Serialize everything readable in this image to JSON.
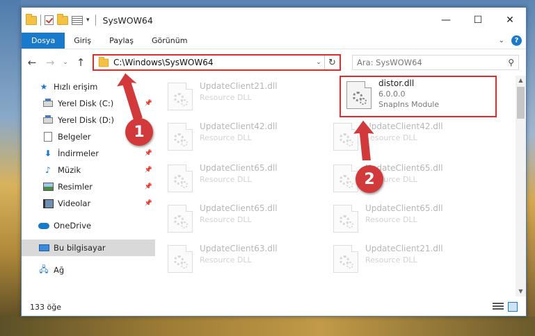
{
  "window": {
    "title": "SysWOW64",
    "controls": {
      "minimize": "—",
      "maximize": "☐",
      "close": "✕"
    }
  },
  "quick_access_toolbar": {
    "icons": [
      "folder-icon",
      "properties-check-icon",
      "new-folder-icon",
      "properties-icon",
      "dropdown-icon"
    ]
  },
  "ribbon": {
    "tabs": [
      "Dosya",
      "Giriş",
      "Paylaş",
      "Görünüm"
    ],
    "collapse_glyph": "⌄",
    "help_glyph": "?"
  },
  "navigation": {
    "back_glyph": "←",
    "forward_glyph": "→",
    "recent_glyph": "⌄",
    "up_glyph": "↑",
    "address_path": "C:\\Windows\\SysWOW64",
    "address_dropdown_glyph": "⌄",
    "refresh_glyph": "↻",
    "search_placeholder": "Ara: SysWOW64",
    "search_glyph": "⚲"
  },
  "sidebar": {
    "quick_access": "Hızlı erişim",
    "items": [
      {
        "label": "Yerel Disk (C:)",
        "icon": "drive-icon"
      },
      {
        "label": "Yerel Disk (D:)",
        "icon": "drive-icon"
      },
      {
        "label": "Belgeler",
        "icon": "documents-icon"
      },
      {
        "label": "İndirmeler",
        "icon": "downloads-icon"
      },
      {
        "label": "Müzik",
        "icon": "music-icon"
      },
      {
        "label": "Resimler",
        "icon": "pictures-icon"
      },
      {
        "label": "Videolar",
        "icon": "videos-icon"
      }
    ],
    "onedrive": "OneDrive",
    "this_pc": "Bu bilgisayar",
    "network": "Ağ",
    "pin_glyph": "📌"
  },
  "files": {
    "left_column": [
      {
        "name": "UpdateClient21.dll",
        "desc": "Resource DLL"
      },
      {
        "name": "UpdateClient42.dll",
        "desc": "Resource DLL"
      },
      {
        "name": "UpdateClient65.dll",
        "desc": "Resource DLL"
      },
      {
        "name": "UpdateClient65.dll",
        "desc": "Resource DLL"
      },
      {
        "name": "UpdateClient63.dll",
        "desc": "Resource DLL"
      }
    ],
    "right_column": [
      {
        "name": "distor.dll",
        "desc": "6.0.0.0",
        "desc2": "SnapIns Module",
        "highlighted": true
      },
      {
        "name": "UpdateClient42.dll",
        "desc": "Resource DLL"
      },
      {
        "name": "UpdateClient65.dll",
        "desc": "Resource DLL"
      },
      {
        "name": "UpdateClient65.dll",
        "desc": "Resource DLL"
      },
      {
        "name": "UpdateClient21.dll",
        "desc": "Resource DLL"
      }
    ]
  },
  "status": {
    "count": "133 öğe"
  },
  "annotations": [
    {
      "number": "1",
      "color": "#d2393a"
    },
    {
      "number": "2",
      "color": "#d2393a"
    }
  ],
  "colors": {
    "accent": "#1979ca",
    "highlight": "#e02b2b"
  }
}
